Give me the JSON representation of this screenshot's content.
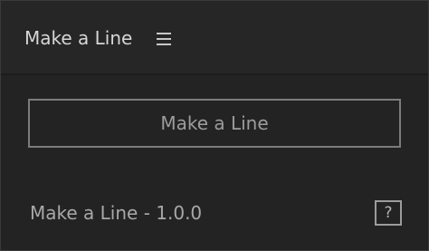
{
  "panel": {
    "title": "Make a Line",
    "menu_icon": "hamburger-menu-icon"
  },
  "main": {
    "make_line_button_label": "Make a Line",
    "version_text": "Make a Line - 1.0.0",
    "help_button_label": "?"
  },
  "colors": {
    "background": "#232323",
    "header_background": "#262626",
    "button_border": "#7c7c7c",
    "button_text": "#9c9c9c",
    "title_text": "#d6d6d6"
  }
}
